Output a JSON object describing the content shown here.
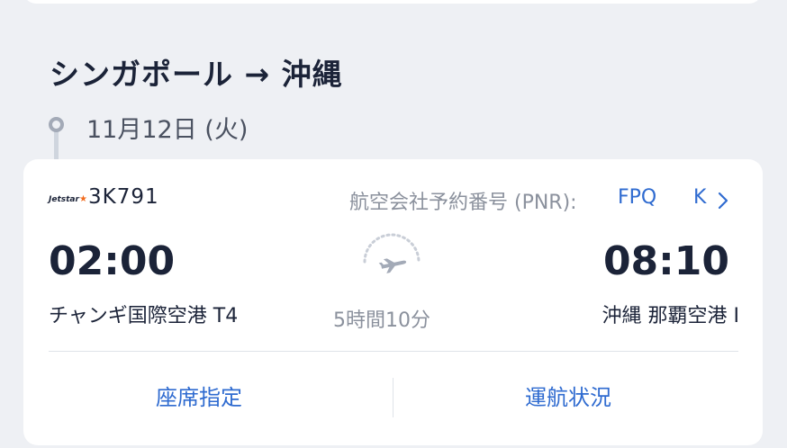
{
  "route": {
    "title": "シンガポール → 沖縄"
  },
  "date": {
    "label": "11月12日 (火)"
  },
  "flight": {
    "airline_logo_text": "Jetstar",
    "number": "3K791",
    "pnr_label": "航空会社予約番号 (PNR):",
    "pnr_value": "FPQ",
    "pnr_suffix": "K",
    "departure_time": "02:00",
    "arrival_time": "08:10",
    "departure_airport": "チャンギ国際空港 T4",
    "arrival_airport": "沖縄 那覇空港 I",
    "duration": "5時間10分"
  },
  "actions": {
    "seat_label": "座席指定",
    "status_label": "運航状況"
  },
  "colors": {
    "accent": "#2f6bd0",
    "text_dark": "#1b2338",
    "text_muted": "#8b919d",
    "background": "#eef0f4",
    "logo_star": "#f26b1d"
  },
  "icons": {
    "timeline": "timeline-dot-icon",
    "chevron": "chevron-right-icon",
    "plane": "airplane-icon"
  }
}
